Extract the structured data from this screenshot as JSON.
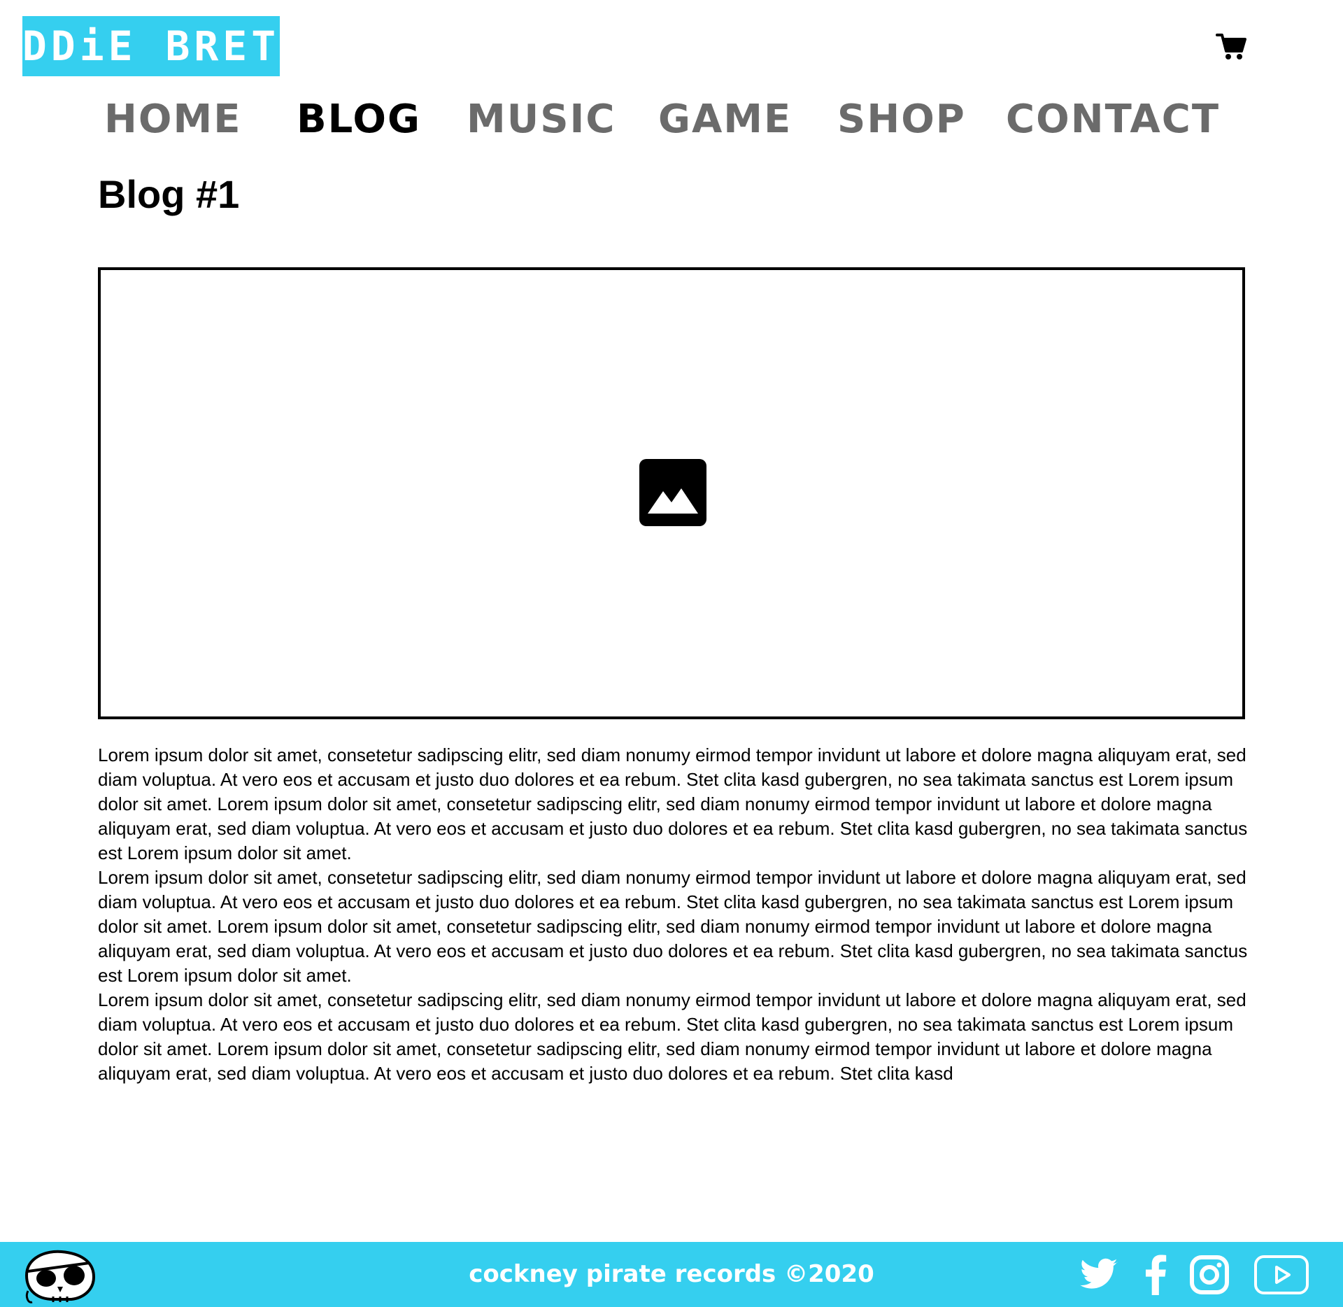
{
  "header": {
    "logo_text": "EDDiE BRETT",
    "cart_icon": "shopping-cart-icon"
  },
  "nav": {
    "items": [
      {
        "label": "HOME",
        "active": false
      },
      {
        "label": "BLOG",
        "active": true
      },
      {
        "label": "MUSIC",
        "active": false
      },
      {
        "label": "GAME",
        "active": false
      },
      {
        "label": "SHOP",
        "active": false
      },
      {
        "label": "CONTACT",
        "active": false
      }
    ]
  },
  "main": {
    "title": "Blog #1",
    "image_icon": "image-placeholder-icon",
    "paragraphs": [
      "Lorem ipsum dolor sit amet, consetetur sadipscing elitr, sed diam nonumy eirmod tempor invidunt ut labore et dolore magna aliquyam erat, sed diam voluptua. At vero eos et accusam et justo duo dolores et ea rebum. Stet clita kasd gubergren, no sea takimata sanctus est Lorem ipsum dolor sit amet. Lorem ipsum dolor sit amet, consetetur sadipscing elitr, sed diam nonumy eirmod tempor invidunt ut labore et dolore magna aliquyam erat, sed diam voluptua. At vero eos et accusam et justo duo dolores et ea rebum. Stet clita kasd gubergren, no sea takimata sanctus est Lorem ipsum dolor sit amet.",
      "Lorem ipsum dolor sit amet, consetetur sadipscing elitr, sed diam nonumy eirmod tempor invidunt ut labore et dolore magna aliquyam erat, sed diam voluptua. At vero eos et accusam et justo duo dolores et ea rebum. Stet clita kasd gubergren, no sea takimata sanctus est Lorem ipsum dolor sit amet. Lorem ipsum dolor sit amet, consetetur sadipscing elitr, sed diam nonumy eirmod tempor invidunt ut labore et dolore magna aliquyam erat, sed diam voluptua. At vero eos et accusam et justo duo dolores et ea rebum. Stet clita kasd gubergren, no sea takimata sanctus est Lorem ipsum dolor sit amet.",
      "Lorem ipsum dolor sit amet, consetetur sadipscing elitr, sed diam nonumy eirmod tempor invidunt ut labore et dolore magna aliquyam erat, sed diam voluptua. At vero eos et accusam et justo duo dolores et ea rebum. Stet clita kasd gubergren, no sea takimata sanctus est Lorem ipsum dolor sit amet. Lorem ipsum dolor sit amet, consetetur sadipscing elitr, sed diam nonumy eirmod tempor invidunt ut labore et dolore magna aliquyam erat, sed diam voluptua. At vero eos et accusam et justo duo dolores et ea rebum. Stet clita kasd"
    ]
  },
  "footer": {
    "logo_icon": "pirate-skull-icon",
    "copyright": "cockney pirate records ©2020",
    "social": [
      {
        "icon": "twitter-icon"
      },
      {
        "icon": "facebook-icon"
      },
      {
        "icon": "instagram-icon"
      },
      {
        "icon": "youtube-icon"
      }
    ]
  },
  "colors": {
    "brand": "#35cfef",
    "nav_inactive": "#6b6b6b",
    "nav_active": "#000000",
    "text": "#000000",
    "background": "#ffffff"
  }
}
